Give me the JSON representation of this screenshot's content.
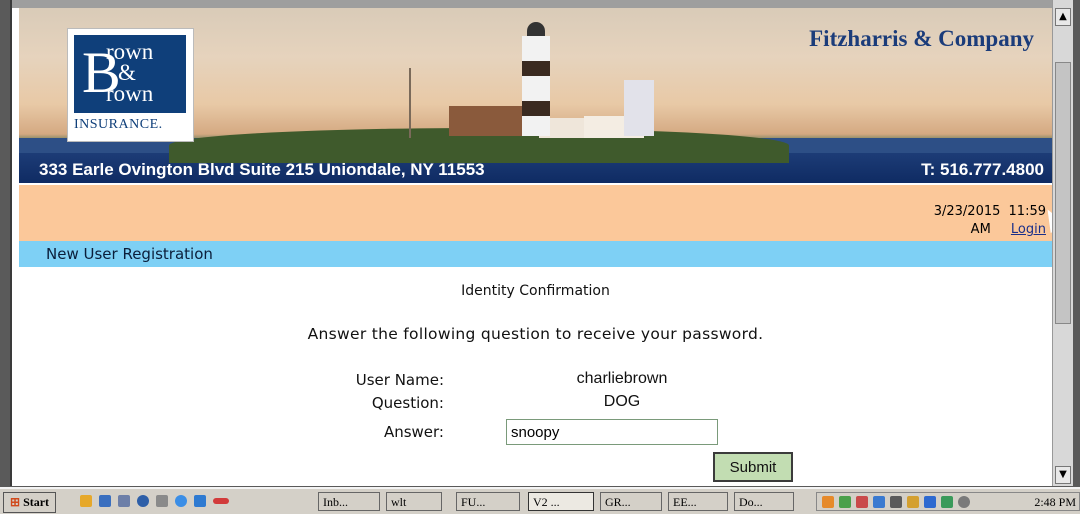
{
  "banner": {
    "logo": {
      "line1": "rown",
      "line2": "&",
      "line3": "rown",
      "insurance": "INSURANCE."
    },
    "company": "Fitzharris & Company",
    "address": "333 Earle Ovington Blvd Suite 215 Uniondale, NY 11553",
    "phone": "T: 516.777.4800"
  },
  "statusbar": {
    "date": "3/23/2015",
    "time": "11:59",
    "ampm": "AM",
    "login": "Login"
  },
  "section_title": "New User Registration",
  "form": {
    "heading": "Identity Confirmation",
    "instruction": "Answer the following question to receive your password.",
    "username_label": "User Name:",
    "username_value": "charliebrown",
    "question_label": "Question:",
    "question_value": "DOG",
    "answer_label": "Answer:",
    "answer_value": "snoopy",
    "submit_label": "Submit"
  },
  "taskbar": {
    "start": "Start",
    "tasks": [
      "Inb...",
      "wlt",
      "FU...",
      "V2 ...",
      "GR...",
      "EE...",
      "Do..."
    ],
    "clock": "2:48 PM"
  },
  "colors": {
    "orange_bar": "#fbc89a",
    "blue_bar": "#7ed0f5",
    "brand_blue": "#0f3f7a",
    "submit_bg": "#c2ddb2"
  }
}
